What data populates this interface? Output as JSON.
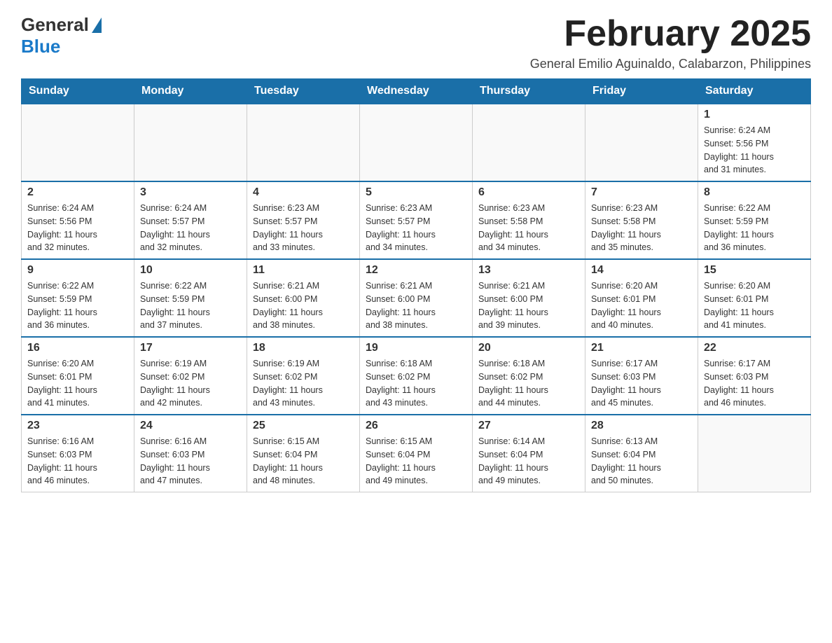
{
  "logo": {
    "general": "General",
    "blue": "Blue"
  },
  "title": "February 2025",
  "subtitle": "General Emilio Aguinaldo, Calabarzon, Philippines",
  "days_of_week": [
    "Sunday",
    "Monday",
    "Tuesday",
    "Wednesday",
    "Thursday",
    "Friday",
    "Saturday"
  ],
  "weeks": [
    [
      {
        "day": "",
        "info": ""
      },
      {
        "day": "",
        "info": ""
      },
      {
        "day": "",
        "info": ""
      },
      {
        "day": "",
        "info": ""
      },
      {
        "day": "",
        "info": ""
      },
      {
        "day": "",
        "info": ""
      },
      {
        "day": "1",
        "info": "Sunrise: 6:24 AM\nSunset: 5:56 PM\nDaylight: 11 hours\nand 31 minutes."
      }
    ],
    [
      {
        "day": "2",
        "info": "Sunrise: 6:24 AM\nSunset: 5:56 PM\nDaylight: 11 hours\nand 32 minutes."
      },
      {
        "day": "3",
        "info": "Sunrise: 6:24 AM\nSunset: 5:57 PM\nDaylight: 11 hours\nand 32 minutes."
      },
      {
        "day": "4",
        "info": "Sunrise: 6:23 AM\nSunset: 5:57 PM\nDaylight: 11 hours\nand 33 minutes."
      },
      {
        "day": "5",
        "info": "Sunrise: 6:23 AM\nSunset: 5:57 PM\nDaylight: 11 hours\nand 34 minutes."
      },
      {
        "day": "6",
        "info": "Sunrise: 6:23 AM\nSunset: 5:58 PM\nDaylight: 11 hours\nand 34 minutes."
      },
      {
        "day": "7",
        "info": "Sunrise: 6:23 AM\nSunset: 5:58 PM\nDaylight: 11 hours\nand 35 minutes."
      },
      {
        "day": "8",
        "info": "Sunrise: 6:22 AM\nSunset: 5:59 PM\nDaylight: 11 hours\nand 36 minutes."
      }
    ],
    [
      {
        "day": "9",
        "info": "Sunrise: 6:22 AM\nSunset: 5:59 PM\nDaylight: 11 hours\nand 36 minutes."
      },
      {
        "day": "10",
        "info": "Sunrise: 6:22 AM\nSunset: 5:59 PM\nDaylight: 11 hours\nand 37 minutes."
      },
      {
        "day": "11",
        "info": "Sunrise: 6:21 AM\nSunset: 6:00 PM\nDaylight: 11 hours\nand 38 minutes."
      },
      {
        "day": "12",
        "info": "Sunrise: 6:21 AM\nSunset: 6:00 PM\nDaylight: 11 hours\nand 38 minutes."
      },
      {
        "day": "13",
        "info": "Sunrise: 6:21 AM\nSunset: 6:00 PM\nDaylight: 11 hours\nand 39 minutes."
      },
      {
        "day": "14",
        "info": "Sunrise: 6:20 AM\nSunset: 6:01 PM\nDaylight: 11 hours\nand 40 minutes."
      },
      {
        "day": "15",
        "info": "Sunrise: 6:20 AM\nSunset: 6:01 PM\nDaylight: 11 hours\nand 41 minutes."
      }
    ],
    [
      {
        "day": "16",
        "info": "Sunrise: 6:20 AM\nSunset: 6:01 PM\nDaylight: 11 hours\nand 41 minutes."
      },
      {
        "day": "17",
        "info": "Sunrise: 6:19 AM\nSunset: 6:02 PM\nDaylight: 11 hours\nand 42 minutes."
      },
      {
        "day": "18",
        "info": "Sunrise: 6:19 AM\nSunset: 6:02 PM\nDaylight: 11 hours\nand 43 minutes."
      },
      {
        "day": "19",
        "info": "Sunrise: 6:18 AM\nSunset: 6:02 PM\nDaylight: 11 hours\nand 43 minutes."
      },
      {
        "day": "20",
        "info": "Sunrise: 6:18 AM\nSunset: 6:02 PM\nDaylight: 11 hours\nand 44 minutes."
      },
      {
        "day": "21",
        "info": "Sunrise: 6:17 AM\nSunset: 6:03 PM\nDaylight: 11 hours\nand 45 minutes."
      },
      {
        "day": "22",
        "info": "Sunrise: 6:17 AM\nSunset: 6:03 PM\nDaylight: 11 hours\nand 46 minutes."
      }
    ],
    [
      {
        "day": "23",
        "info": "Sunrise: 6:16 AM\nSunset: 6:03 PM\nDaylight: 11 hours\nand 46 minutes."
      },
      {
        "day": "24",
        "info": "Sunrise: 6:16 AM\nSunset: 6:03 PM\nDaylight: 11 hours\nand 47 minutes."
      },
      {
        "day": "25",
        "info": "Sunrise: 6:15 AM\nSunset: 6:04 PM\nDaylight: 11 hours\nand 48 minutes."
      },
      {
        "day": "26",
        "info": "Sunrise: 6:15 AM\nSunset: 6:04 PM\nDaylight: 11 hours\nand 49 minutes."
      },
      {
        "day": "27",
        "info": "Sunrise: 6:14 AM\nSunset: 6:04 PM\nDaylight: 11 hours\nand 49 minutes."
      },
      {
        "day": "28",
        "info": "Sunrise: 6:13 AM\nSunset: 6:04 PM\nDaylight: 11 hours\nand 50 minutes."
      },
      {
        "day": "",
        "info": ""
      }
    ]
  ]
}
